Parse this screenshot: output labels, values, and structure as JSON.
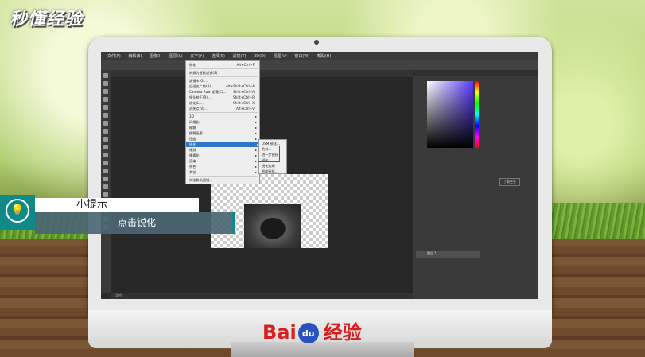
{
  "brand": {
    "logo_text": "秒懂经验"
  },
  "photoshop": {
    "menubar": [
      "文件(F)",
      "编辑(E)",
      "图像(I)",
      "图层(L)",
      "文字(Y)",
      "选择(S)",
      "滤镜(T)",
      "3D(D)",
      "视图(V)",
      "窗口(W)",
      "帮助(H)"
    ],
    "filter_menu": {
      "items": [
        {
          "label": "锐化",
          "shortcut": "Alt+Ctrl+F"
        },
        {
          "label": "转换为智能滤镜(S)",
          "shortcut": ""
        },
        {
          "label": "滤镜库(G)...",
          "shortcut": ""
        },
        {
          "label": "自适应广角(A)...",
          "shortcut": "Alt+Shift+Ctrl+A"
        },
        {
          "label": "Camera Raw 滤镜(C)...",
          "shortcut": "Shift+Ctrl+A"
        },
        {
          "label": "镜头校正(R)...",
          "shortcut": "Shift+Ctrl+R"
        },
        {
          "label": "液化(L)...",
          "shortcut": "Shift+Ctrl+X"
        },
        {
          "label": "消失点(V)...",
          "shortcut": "Alt+Ctrl+V"
        },
        {
          "label": "3D",
          "shortcut": ""
        },
        {
          "label": "风格化",
          "shortcut": ""
        },
        {
          "label": "模糊",
          "shortcut": ""
        },
        {
          "label": "模糊画廊",
          "shortcut": ""
        },
        {
          "label": "扭曲",
          "shortcut": ""
        },
        {
          "label": "锐化",
          "shortcut": "",
          "selected": true
        },
        {
          "label": "视频",
          "shortcut": ""
        },
        {
          "label": "像素化",
          "shortcut": ""
        },
        {
          "label": "渲染",
          "shortcut": ""
        },
        {
          "label": "杂色",
          "shortcut": ""
        },
        {
          "label": "其它",
          "shortcut": ""
        },
        {
          "label": "浏览联机滤镜...",
          "shortcut": ""
        }
      ]
    },
    "sharpen_submenu": [
      "USM 锐化...",
      "防抖...",
      "进一步锐化",
      "锐化",
      "锐化边缘",
      "智能锐化..."
    ],
    "learn_button": "了解更多",
    "layer_name": "图层 1",
    "status_zoom": "100%"
  },
  "tip": {
    "title": "小提示",
    "text": "点击锐化"
  },
  "footer": {
    "logo_bai": "Bai",
    "logo_du": "du",
    "logo_jingyan": "经验"
  }
}
